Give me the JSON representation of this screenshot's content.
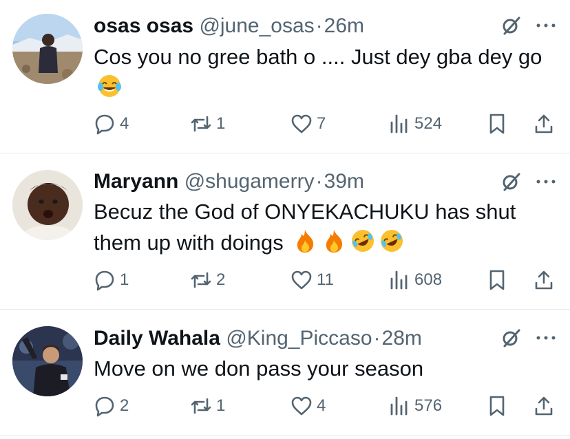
{
  "tweets": [
    {
      "name": "osas osas",
      "handle": "@june_osas",
      "separator": "·",
      "time": "26m",
      "text": "Cos you no gree bath o .... Just dey gba dey go",
      "emojis": [
        "face-with-tears-of-joy"
      ],
      "replies": "4",
      "reposts": "1",
      "likes": "7",
      "views": "524"
    },
    {
      "name": "Maryann",
      "handle": "@shugamerry",
      "separator": "·",
      "time": "39m",
      "text": "Becuz the  God of ONYEKACHUKU has shut them up with doings",
      "emojis": [
        "fire",
        "fire",
        "rolling-on-floor-laughing",
        "rolling-on-floor-laughing"
      ],
      "replies": "1",
      "reposts": "2",
      "likes": "11",
      "views": "608"
    },
    {
      "name": "Daily Wahala",
      "handle": "@King_Piccaso",
      "separator": "·",
      "time": "28m",
      "text": "Move on we don pass your season",
      "emojis": [],
      "replies": "2",
      "reposts": "1",
      "likes": "4",
      "views": "576"
    }
  ],
  "colors": {
    "text": "#0f1419",
    "secondary": "#536471",
    "divider": "#e6e9ec",
    "emoji_yellow": "#fbc02d",
    "fire_orange": "#f57c00"
  }
}
